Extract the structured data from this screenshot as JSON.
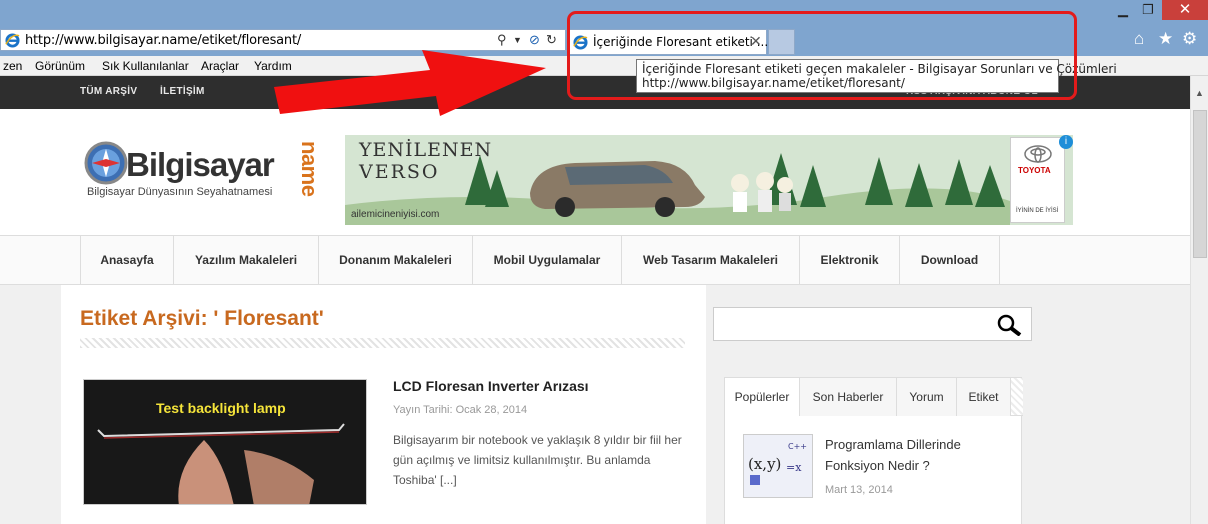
{
  "browser": {
    "address_url": "http://www.bilgisayar.name/etiket/floresant/",
    "tab_title": "İçeriğinde Floresant etiketi ...",
    "tooltip_line1": "İçeriğinde Floresant etiketi geçen makaleler - Bilgisayar Sorunları ve Çözümleri",
    "tooltip_line2": "http://www.bilgisayar.name/etiket/floresant/",
    "menu": [
      "zen",
      "Görünüm",
      "Sık Kullanılanlar",
      "Araçlar",
      "Yardım"
    ],
    "close_glyph": "✕",
    "highlight_color": "#e31b1b"
  },
  "site": {
    "topbar": {
      "links": [
        "TÜM ARŞİV",
        "İLETİŞİM"
      ],
      "rss": "RSS ARŞİVİNA ABONE OL"
    },
    "logo": {
      "word": "Bilgisayar",
      "suffix": "name",
      "tagline": "Bilgisayar Dünyasının Seyahatnamesi"
    },
    "ad": {
      "line1": "YENİLENEN",
      "line2": "VERSO",
      "site": "ailemicineniyisi.com",
      "brand": "TOYOTA",
      "slogan": "İYİNİN DE İYİSİ"
    },
    "nav": [
      "Anasayfa",
      "Yazılım Makaleleri",
      "Donanım Makaleleri",
      "Mobil Uygulamalar",
      "Web Tasarım Makaleleri",
      "Elektronik",
      "Download"
    ]
  },
  "main": {
    "page_title": "Etiket Arşivi: ' Floresant'",
    "article": {
      "thumb_caption": "Test backlight lamp",
      "title": "LCD Floresan Inverter Arızası",
      "date": "Yayın Tarihi: Ocak 28, 2014",
      "excerpt": "Bilgisayarım bir notebook ve yaklaşık 8 yıldır bir fiil her gün açılmış ve limitsiz kullanılmıştır. Bu anlamda Toshiba' [...]"
    }
  },
  "sidebar": {
    "tabs": [
      "Popülerler",
      "Son Haberler",
      "Yorum",
      "Etiket"
    ],
    "post": {
      "title": "Programlama Dillerinde Fonksiyon Nedir ?",
      "date": "Mart 13, 2014"
    }
  }
}
